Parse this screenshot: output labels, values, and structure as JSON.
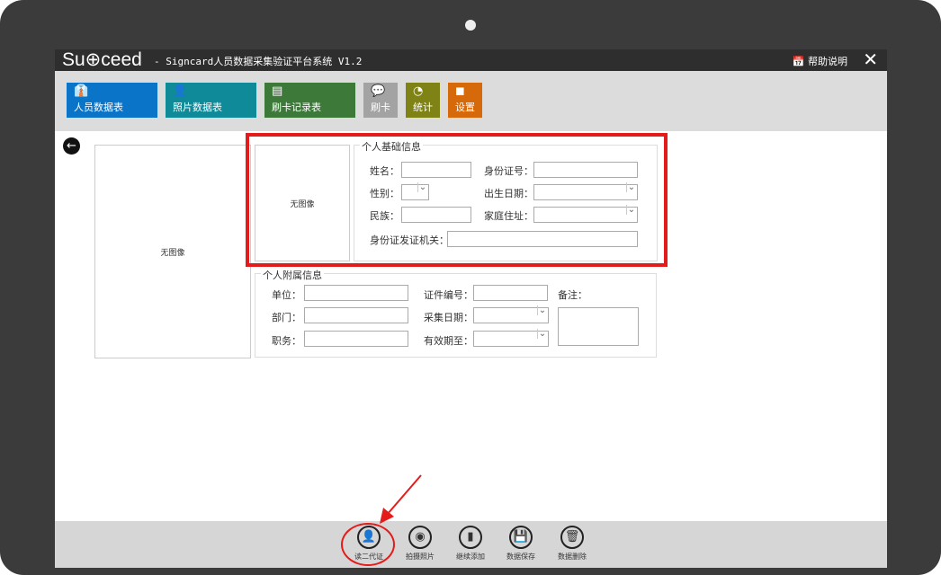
{
  "window": {
    "logo": "Su⊕ceed",
    "title": "- Signcard人员数据采集验证平台系统 V1.2",
    "help": "帮助说明",
    "close": "✕"
  },
  "toolbar": [
    {
      "label": "人员数据表",
      "icon": "tie-icon",
      "glyph": "👔",
      "color": "#0a74c8"
    },
    {
      "label": "照片数据表",
      "icon": "person-icon",
      "glyph": "👤",
      "color": "#0e8a99"
    },
    {
      "label": "刷卡记录表",
      "icon": "list-icon",
      "glyph": "▤",
      "color": "#3d7a3a"
    },
    {
      "label": "刷卡",
      "icon": "chat-icon",
      "glyph": "💬",
      "color": "#a3a3a3"
    },
    {
      "label": "统计",
      "icon": "stats-icon",
      "glyph": "◔",
      "color": "#7f8214"
    },
    {
      "label": "设置",
      "icon": "box-icon",
      "glyph": "◼",
      "color": "#d66a0a"
    }
  ],
  "photo": {
    "main": "无图像",
    "id": "无图像"
  },
  "basic": {
    "title": "个人基础信息",
    "name": "姓名：",
    "idno": "身份证号：",
    "gender": "性别：",
    "birth": "出生日期：",
    "nation": "民族：",
    "address": "家庭住址：",
    "authority": "身份证发证机关："
  },
  "extra": {
    "title": "个人附属信息",
    "unit": "单位：",
    "certno": "证件编号：",
    "remark": "备注：",
    "dept": "部门：",
    "collect": "采集日期：",
    "job": "职务：",
    "expire": "有效期至："
  },
  "bottom": [
    {
      "label": "读二代证",
      "icon": "id-card-reader-icon",
      "glyph": "👤"
    },
    {
      "label": "拍摄照片",
      "icon": "eye-icon",
      "glyph": "◉"
    },
    {
      "label": "继续添加",
      "icon": "document-icon",
      "glyph": "▮"
    },
    {
      "label": "数据保存",
      "icon": "save-icon",
      "glyph": "💾"
    },
    {
      "label": "数据删除",
      "icon": "trash-icon",
      "glyph": "🗑"
    }
  ]
}
